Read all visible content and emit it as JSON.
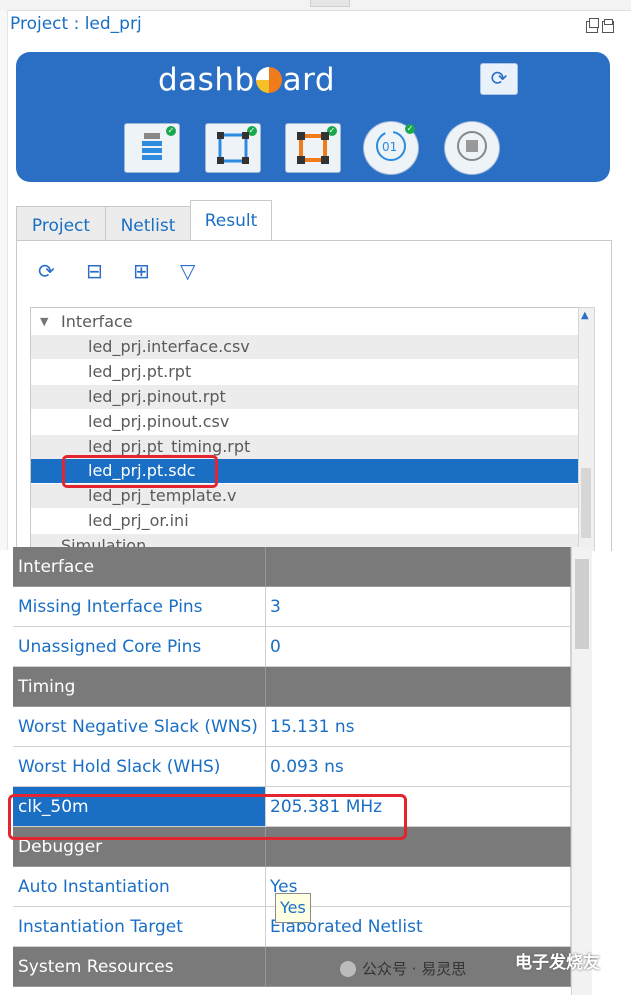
{
  "project": {
    "title": "Project : led_prj"
  },
  "dashboard": {
    "logo_text_left": "dashb",
    "logo_text_right": "ard",
    "sync_icon": "sync-icon",
    "tools": [
      "synthesis-icon",
      "placement-icon",
      "routing-icon",
      "bitstream-icon",
      "stop-icon"
    ]
  },
  "tabs": [
    {
      "label": "Project"
    },
    {
      "label": "Netlist"
    },
    {
      "label": "Result",
      "active": true
    }
  ],
  "result_toolbar": [
    "refresh-icon",
    "collapse-icon",
    "expand-icon",
    "filter-icon"
  ],
  "tree": {
    "group": "Interface",
    "files": [
      "led_prj.interface.csv",
      "led_prj.pt.rpt",
      "led_prj.pinout.rpt",
      "led_prj.pinout.csv",
      "led_prj.pt_timing.rpt",
      "led_prj.pt.sdc",
      "led_prj_template.v",
      "led_prj_or.ini"
    ],
    "next_group": "Simulation",
    "selected": "led_prj.pt.sdc"
  },
  "grid": {
    "rows": [
      {
        "type": "header",
        "label": "Interface",
        "value": ""
      },
      {
        "type": "row",
        "label": "Missing Interface Pins",
        "value": "3"
      },
      {
        "type": "row",
        "label": "Unassigned Core Pins",
        "value": "0"
      },
      {
        "type": "header",
        "label": "Timing",
        "value": ""
      },
      {
        "type": "row",
        "label": "Worst Negative Slack (WNS)",
        "value": "15.131 ns"
      },
      {
        "type": "row",
        "label": "Worst Hold Slack (WHS)",
        "value": "0.093 ns"
      },
      {
        "type": "selected",
        "label": "clk_50m",
        "value": "205.381 MHz"
      },
      {
        "type": "header",
        "label": "Debugger",
        "value": ""
      },
      {
        "type": "row",
        "label": "Auto Instantiation",
        "value": "Yes"
      },
      {
        "type": "row",
        "label": "Instantiation Target",
        "value": "Elaborated Netlist"
      },
      {
        "type": "header",
        "label": "System Resources",
        "value": ""
      }
    ]
  },
  "tooltip": "Yes",
  "watermark": {
    "text": "公众号 · 易灵思",
    "brand": "电子发烧友"
  }
}
